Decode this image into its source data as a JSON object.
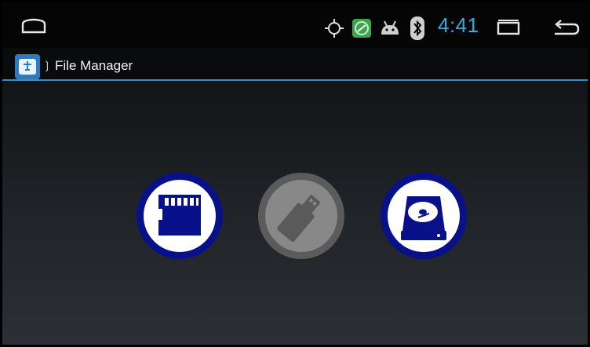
{
  "status_bar": {
    "time": "4:41",
    "icons": [
      "home-icon",
      "gps-icon",
      "media-icon",
      "android-icon",
      "bluetooth-icon",
      "recent-apps-icon",
      "back-icon"
    ],
    "accent_color": "#33a9dc"
  },
  "action_bar": {
    "app_icon": "file-manager-icon",
    "title": "File Manager"
  },
  "storage_options": [
    {
      "name": "sd-card",
      "icon": "sd-card-icon",
      "enabled": true
    },
    {
      "name": "usb-drive",
      "icon": "usb-drive-icon",
      "enabled": false
    },
    {
      "name": "hard-drive",
      "icon": "hard-drive-icon",
      "enabled": true
    }
  ]
}
